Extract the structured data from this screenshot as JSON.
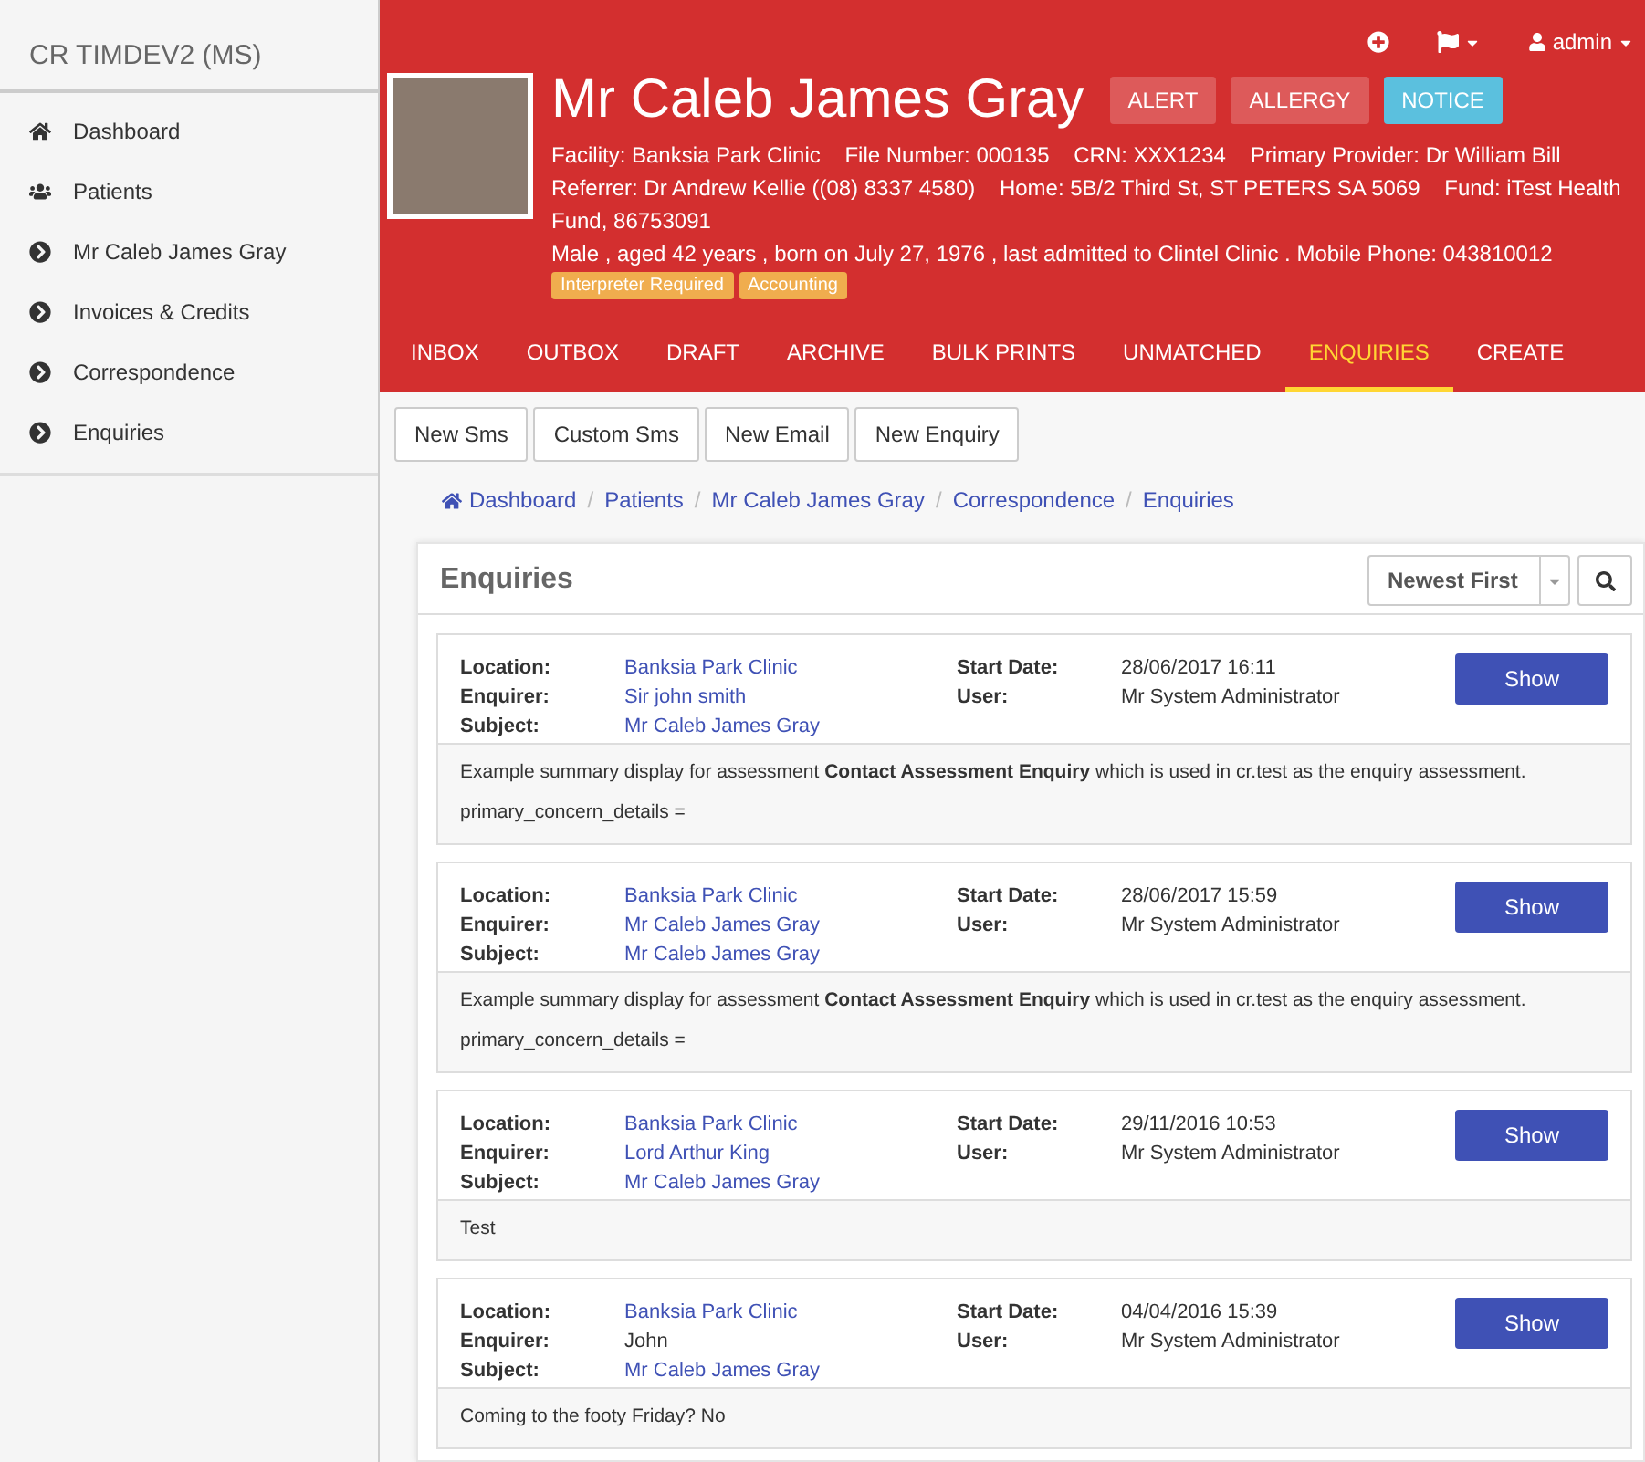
{
  "sidebar": {
    "title": "CR TIMDEV2 (MS)",
    "items": [
      {
        "label": "Dashboard",
        "kind": "home"
      },
      {
        "label": "Patients",
        "kind": "users"
      },
      {
        "label": "Mr Caleb James Gray",
        "kind": "chevron"
      },
      {
        "label": "Invoices & Credits",
        "kind": "chevron"
      },
      {
        "label": "Correspondence",
        "kind": "chevron"
      },
      {
        "label": "Enquiries",
        "kind": "chevron"
      }
    ]
  },
  "topbar": {
    "items": [
      {
        "kind": "add"
      },
      {
        "kind": "flag"
      },
      {
        "kind": "user",
        "label": "admin"
      }
    ]
  },
  "patient": {
    "name": "Mr Caleb James Gray",
    "badges": [
      {
        "label": "ALERT",
        "color": "#dd5a5a"
      },
      {
        "label": "ALLERGY",
        "color": "#dd5a5a"
      },
      {
        "label": "NOTICE",
        "color": "#5bc0de"
      }
    ],
    "details": [
      "Facility: Banksia Park Clinic",
      "File Number: 000135",
      "CRN: XXX1234",
      "Primary Provider: Dr William Bill",
      "Referrer: Dr Andrew Kellie ((08) 8337 4580)",
      "Home: 5B/2 Third St, ST PETERS SA 5069",
      "Fund: iTest Health Fund, 86753091"
    ],
    "summary": "Male , aged 42 years , born on July 27, 1976 , last admitted to Clintel Clinic . Mobile Phone: 043810012",
    "tags": [
      "Interpreter Required",
      "Accounting"
    ]
  },
  "tabs": [
    {
      "label": "INBOX",
      "selected": false
    },
    {
      "label": "OUTBOX",
      "selected": false
    },
    {
      "label": "DRAFT",
      "selected": false
    },
    {
      "label": "ARCHIVE",
      "selected": false
    },
    {
      "label": "BULK PRINTS",
      "selected": false
    },
    {
      "label": "UNMATCHED",
      "selected": false
    },
    {
      "label": "ENQUIRIES",
      "selected": true
    },
    {
      "label": "CREATE",
      "selected": false
    }
  ],
  "actions": [
    "New Sms",
    "Custom Sms",
    "New Email",
    "New Enquiry"
  ],
  "breadcrumbs": [
    "Dashboard",
    "Patients",
    "Mr Caleb James Gray",
    "Correspondence",
    "Enquiries"
  ],
  "breadcrumb_separator": "/",
  "panel": {
    "title": "Enquiries",
    "sort": "Newest First",
    "enquiries": [
      {
        "left": [
          {
            "label": "Location:",
            "value": "Banksia Park Clinic",
            "link": true
          },
          {
            "label": "Enquirer:",
            "value": "Sir john smith",
            "link": true
          },
          {
            "label": "Subject:",
            "value": "Mr Caleb James Gray",
            "link": true
          }
        ],
        "right": [
          {
            "label": "Start Date:",
            "value": "28/06/2017 16:11"
          },
          {
            "label": "User:",
            "value": "Mr System Administrator"
          }
        ],
        "button": "Show",
        "summary": [
          "Example summary display for assessment **Contact Assessment Enquiry** which is used in cr.test as the enquiry assessment.",
          "primary_concern_details ="
        ]
      },
      {
        "left": [
          {
            "label": "Location:",
            "value": "Banksia Park Clinic",
            "link": true
          },
          {
            "label": "Enquirer:",
            "value": "Mr Caleb James Gray",
            "link": true
          },
          {
            "label": "Subject:",
            "value": "Mr Caleb James Gray",
            "link": true
          }
        ],
        "right": [
          {
            "label": "Start Date:",
            "value": "28/06/2017 15:59"
          },
          {
            "label": "User:",
            "value": "Mr System Administrator"
          }
        ],
        "button": "Show",
        "summary": [
          "Example summary display for assessment **Contact Assessment Enquiry** which is used in cr.test as the enquiry assessment.",
          "primary_concern_details ="
        ]
      },
      {
        "left": [
          {
            "label": "Location:",
            "value": "Banksia Park Clinic",
            "link": true
          },
          {
            "label": "Enquirer:",
            "value": "Lord Arthur King",
            "link": true
          },
          {
            "label": "Subject:",
            "value": "Mr Caleb James Gray",
            "link": true
          }
        ],
        "right": [
          {
            "label": "Start Date:",
            "value": "29/11/2016 10:53"
          },
          {
            "label": "User:",
            "value": "Mr System Administrator"
          }
        ],
        "button": "Show",
        "summary": [
          "Test"
        ]
      },
      {
        "left": [
          {
            "label": "Location:",
            "value": "Banksia Park Clinic",
            "link": true
          },
          {
            "label": "Enquirer:",
            "value": "John",
            "link": false
          },
          {
            "label": "Subject:",
            "value": "Mr Caleb James Gray",
            "link": true
          }
        ],
        "right": [
          {
            "label": "Start Date:",
            "value": "04/04/2016 15:39"
          },
          {
            "label": "User:",
            "value": "Mr System Administrator"
          }
        ],
        "button": "Show",
        "summary": [
          "Coming to the footy Friday? No"
        ]
      }
    ]
  }
}
